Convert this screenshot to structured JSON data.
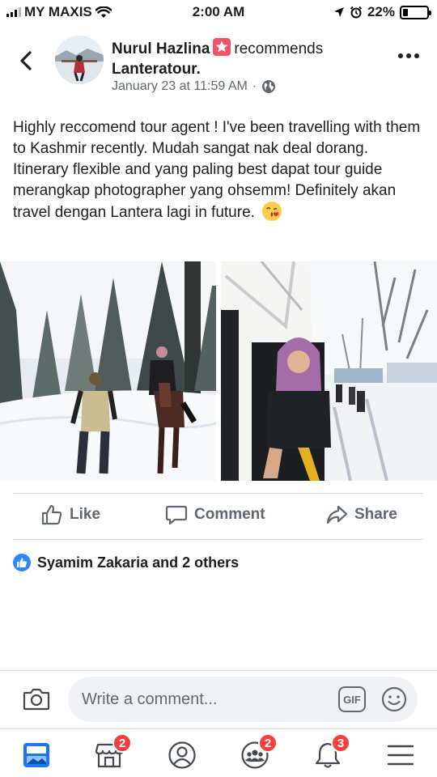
{
  "status_bar": {
    "carrier": "MY MAXIS",
    "time": "2:00 AM",
    "battery": "22%",
    "battery_level": 0.22,
    "icons": [
      "signal-icon",
      "wifi-icon",
      "location-arrow-icon",
      "alarm-icon",
      "battery-icon"
    ]
  },
  "header": {
    "back_icon": "chevron-left-icon",
    "author_name": "Nurul Hazlina",
    "verb": "recommends",
    "page_name": "Lanteratour.",
    "timestamp": "January 23 at 11:59 AM",
    "separator": "·",
    "privacy_icon": "globe-icon",
    "more_icon": "more-dots-icon"
  },
  "post": {
    "text": "Highly reccomend tour agent ! I've been travelling with them to Kashmir recently.  Mudah sangat nak deal dorang. Itinerary flexible and yang paling best dapat tour guide merangkap photographer yang ohsemm! Definitely akan travel dengan Lantera lagi in future.",
    "emoji": "kissing-face-emoji",
    "photos": [
      "photo-snow-forest-horse",
      "photo-van-window-snow-street"
    ]
  },
  "actions": {
    "like_label": "Like",
    "comment_label": "Comment",
    "share_label": "Share"
  },
  "reactions": {
    "summary": "Syamim Zakaria and 2 others",
    "icon": "like-reaction-icon"
  },
  "comment_bar": {
    "placeholder": "Write a comment...",
    "gif_label": "GIF",
    "icons": [
      "camera-icon",
      "gif-icon",
      "smiley-icon"
    ]
  },
  "bottom_nav": {
    "items": [
      {
        "name": "news-feed",
        "icon": "news-feed-icon",
        "badge": ""
      },
      {
        "name": "marketplace",
        "icon": "marketplace-icon",
        "badge": "2"
      },
      {
        "name": "profile",
        "icon": "profile-icon",
        "badge": ""
      },
      {
        "name": "groups",
        "icon": "groups-icon",
        "badge": "2"
      },
      {
        "name": "notifications",
        "icon": "bell-icon",
        "badge": "3"
      },
      {
        "name": "menu",
        "icon": "hamburger-menu-icon",
        "badge": ""
      }
    ]
  },
  "colors": {
    "accent": "#1877f2",
    "badge": "#fa3e3e",
    "text_secondary": "#606770",
    "divider": "#dadde1"
  }
}
